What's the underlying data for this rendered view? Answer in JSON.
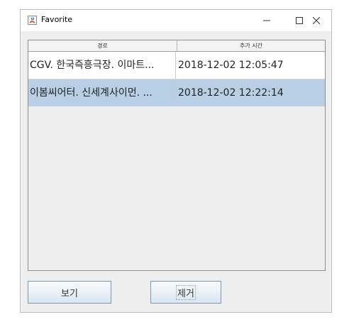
{
  "window": {
    "title": "Favorite",
    "controls": {
      "minimize": "–",
      "maximize": "☐",
      "close": "✕"
    }
  },
  "table": {
    "columns": [
      "경로",
      "추가 시간"
    ],
    "rows": [
      {
        "route": "CGV. 한국즉흥극장. 이마트...",
        "time": "2018-12-02 12:05:47"
      },
      {
        "route": "이봄씨어터. 신세계사이먼. ...",
        "time": "2018-12-02 12:22:14"
      }
    ],
    "selected_row": 2
  },
  "buttons": {
    "view": "보기",
    "remove": "제거"
  },
  "colors": {
    "selected_row": "#b8cfe5",
    "button_border": "#7f97ae"
  }
}
